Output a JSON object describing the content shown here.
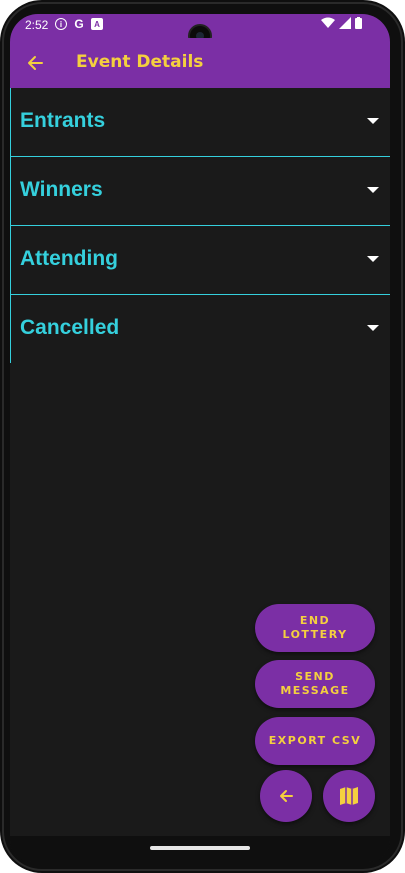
{
  "status_bar": {
    "time": "2:52",
    "icons_left": [
      "info-icon",
      "google-icon",
      "accessibility-icon"
    ],
    "icons_right": [
      "wifi-icon",
      "signal-icon",
      "battery-icon"
    ]
  },
  "app_bar": {
    "title": "Event Details",
    "back_icon": "arrow-left-icon"
  },
  "sections": [
    {
      "label": "Entrants"
    },
    {
      "label": "Winners"
    },
    {
      "label": "Attending"
    },
    {
      "label": "Cancelled"
    }
  ],
  "actions": {
    "end_lottery": "END LOTTERY",
    "send_message": "SEND MESSAGE",
    "export_csv": "EXPORT CSV"
  },
  "fabs": {
    "back_icon": "arrow-left-icon",
    "map_icon": "map-icon"
  },
  "colors": {
    "primary": "#7b2fa5",
    "accent_text": "#f4d03f",
    "section_text": "#35d0dd",
    "background": "#1a1a1a"
  }
}
